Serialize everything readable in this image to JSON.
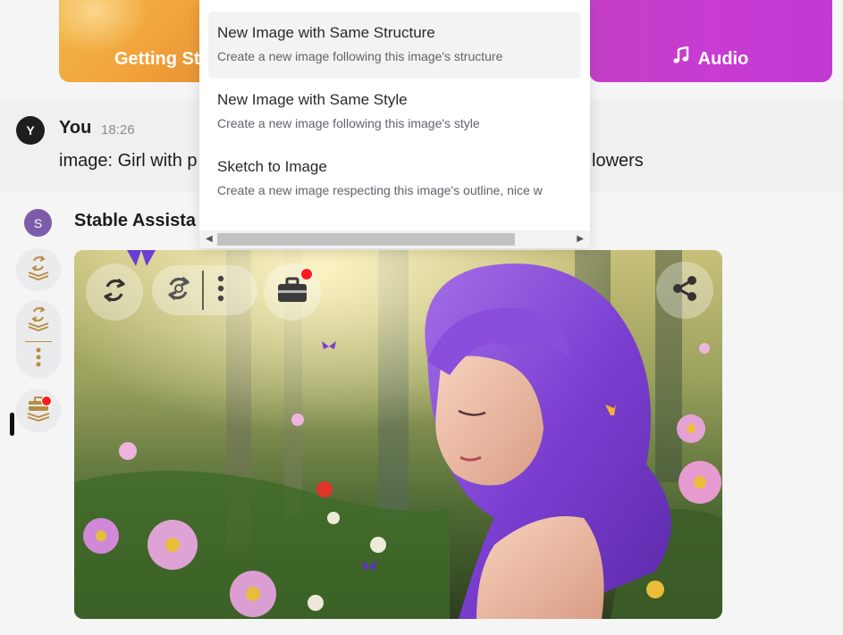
{
  "banners": {
    "getting_started_label": "Getting St",
    "audio_label": "Audio",
    "audio_icon": "music-note-icon"
  },
  "user_message": {
    "avatar_letter": "Y",
    "author": "You",
    "time": "18:26",
    "text_visible_left": "image: Girl with p",
    "text_visible_right": "lowers"
  },
  "assistant": {
    "avatar_letter": "S",
    "name_visible": "Stable Assista"
  },
  "side_toolbar": {
    "icons": [
      "regenerate-stack-icon",
      "regenerate-stack-icon",
      "more-vertical-icon",
      "toolbox-stack-icon"
    ]
  },
  "image_overlay": {
    "icons": [
      "regenerate-icon",
      "variants-icon",
      "more-vertical-icon",
      "toolbox-icon",
      "share-icon"
    ],
    "notification_color": "#ff1a1a"
  },
  "dropdown": {
    "items": [
      {
        "title": "New Image with Same Structure",
        "description": "Create a new image following this image's structure"
      },
      {
        "title": "New Image with Same Style",
        "description": "Create a new image following this image's style"
      },
      {
        "title": "Sketch to Image",
        "description": "Create a new image respecting this image's outline, nice w"
      }
    ]
  },
  "colors": {
    "accent_gold": "#b78d41",
    "audio_banner": "#c43fc7",
    "getting_started_banner": "#f2a43a"
  }
}
